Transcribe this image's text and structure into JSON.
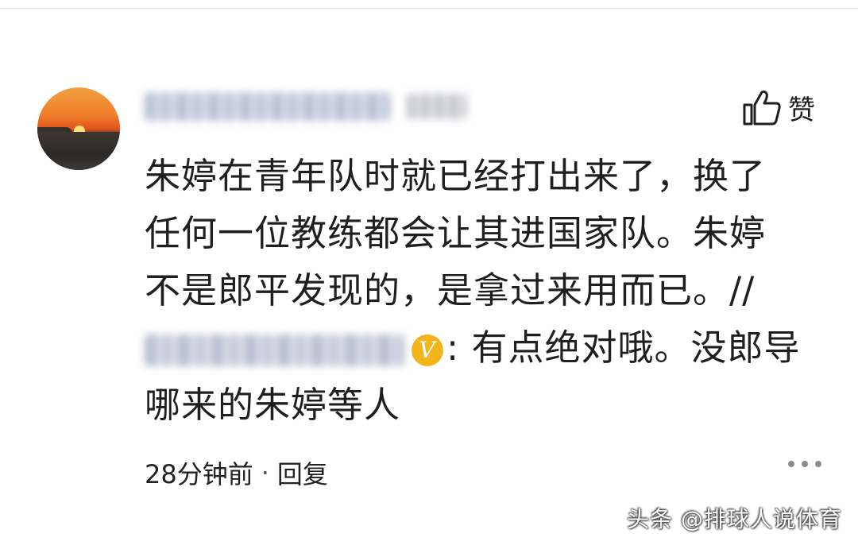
{
  "comment": {
    "avatar_icon": "sunset-avatar",
    "like_icon": "thumbs-up-icon",
    "like_label": "赞",
    "lines": [
      "朱婷在青年队时就已经打出来了，换了",
      "任何一位教练都会让其进国家队。朱婷",
      "不是郎平发现的，是拿过来用而已。//",
      "",
      "哪来的朱婷等人"
    ],
    "quoted_text": ": 有点绝对哦。没郎导",
    "verified_badge": "V",
    "time": "28分钟前",
    "separator": "·",
    "reply_label": "回复",
    "more_icon": "more-dots-icon"
  },
  "watermark": "头条 @排球人说体育",
  "colors": {
    "verified_badge": "#f2b51c",
    "text": "#1f1f1f"
  }
}
